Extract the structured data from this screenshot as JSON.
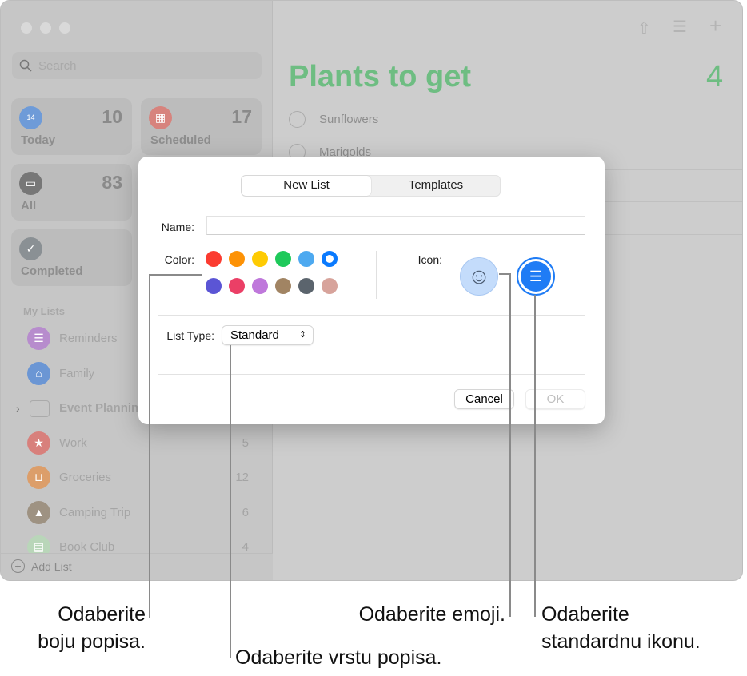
{
  "sidebar": {
    "search_placeholder": "Search",
    "smart_lists": [
      {
        "label": "Today",
        "count": "10",
        "icon": "calendar-today-icon",
        "color": "#6e9bd8",
        "glyph": "14"
      },
      {
        "label": "Scheduled",
        "count": "17",
        "icon": "calendar-icon",
        "color": "#d7837d"
      },
      {
        "label": "All",
        "count": "83",
        "icon": "tray-icon",
        "color": "#777777"
      },
      {
        "label": "Completed",
        "count": "",
        "icon": "checkmark-icon",
        "color": "#8a9094"
      }
    ],
    "section_title": "My Lists",
    "lists": [
      {
        "label": "Reminders",
        "count": "",
        "icon": "list-icon",
        "color": "#b78ccd"
      },
      {
        "label": "Family",
        "count": "",
        "icon": "house-icon",
        "color": "#6b96d4"
      },
      {
        "label": "Event Planning",
        "count": "",
        "icon": "folder-stack-icon",
        "color": ""
      },
      {
        "label": "Work",
        "count": "5",
        "icon": "star-icon",
        "color": "#d8807c"
      },
      {
        "label": "Groceries",
        "count": "12",
        "icon": "basket-icon",
        "color": "#dc9e6a"
      },
      {
        "label": "Camping Trip",
        "count": "6",
        "icon": "tent-icon",
        "color": "#9e9282"
      },
      {
        "label": "Book Club",
        "count": "4",
        "icon": "books-icon",
        "color": "#b9d6b9"
      }
    ],
    "add_list": "Add List"
  },
  "main": {
    "title": "Plants to get",
    "count": "4",
    "title_color": "#6ebd82",
    "tasks": [
      "Sunflowers",
      "Marigolds"
    ]
  },
  "dialog": {
    "tabs": [
      "New List",
      "Templates"
    ],
    "active_tab": "New List",
    "name_label": "Name:",
    "name_value": "",
    "color_label": "Color:",
    "colors": [
      "#fb3b30",
      "#fd9206",
      "#fecb03",
      "#1ec95a",
      "#4da9f0",
      "#0a7afe",
      "#5b55d5",
      "#eb3f66",
      "#bf78db",
      "#a18463",
      "#5b646d",
      "#d7a39b"
    ],
    "selected_color": "#0a7afe",
    "icon_label": "Icon:",
    "icon_options": [
      "emoji-icon",
      "list-icon"
    ],
    "selected_icon": "list-icon",
    "list_type_label": "List Type:",
    "list_type_value": "Standard",
    "cancel": "Cancel",
    "ok": "OK"
  },
  "callouts": {
    "color": [
      "Odaberite",
      "boju popisa."
    ],
    "type": "Odaberite vrstu popisa.",
    "emoji": "Odaberite emoji.",
    "standard": [
      "Odaberite",
      "standardnu ikonu."
    ]
  }
}
